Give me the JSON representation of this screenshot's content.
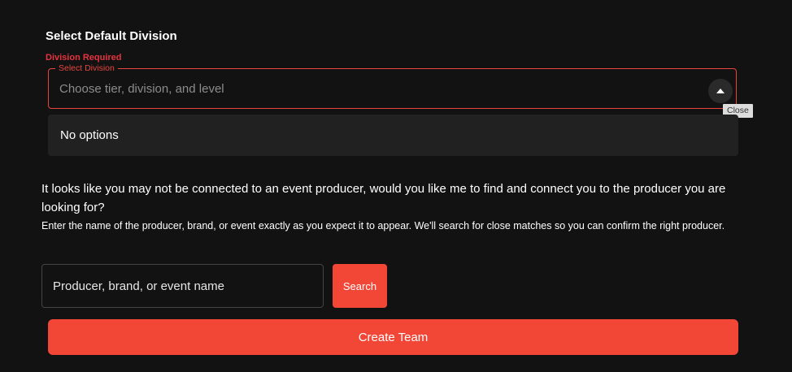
{
  "division": {
    "title": "Select Default Division",
    "error": "Division Required",
    "select_label": "Select Division",
    "select_placeholder": "Choose tier, division, and level",
    "toggle_icon": "caret-up-icon",
    "tooltip": "Close",
    "no_options": "No options"
  },
  "producer": {
    "question": "It looks like you may not be connected to an event producer, would you like me to find and connect you to the producer you are looking for?",
    "instructions": "Enter the name of the producer, brand, or event exactly as you expect it to appear. We'll search for close matches so you can confirm the right producer.",
    "search_placeholder": "Producer, brand, or event name",
    "search_value": "",
    "search_label": "Search"
  },
  "actions": {
    "create_label": "Create Team"
  },
  "colors": {
    "background": "#121212",
    "accent": "#f24636",
    "error": "#e5343f",
    "panel": "#212121"
  }
}
